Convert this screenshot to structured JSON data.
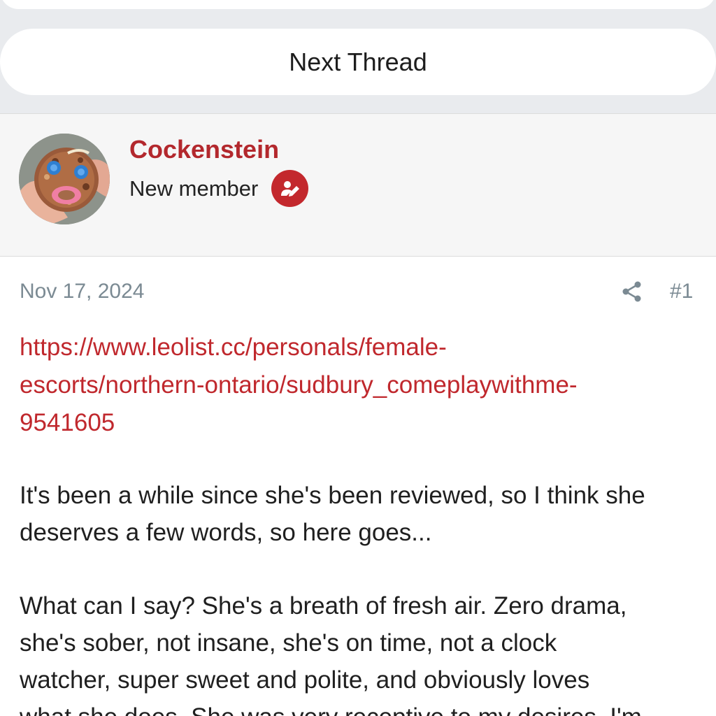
{
  "nav": {
    "next_thread_label": "Next Thread"
  },
  "author": {
    "username": "Cockenstein",
    "user_title": "New member",
    "badge_icon": "user-edit-icon",
    "avatar_icon": "cookie-face-avatar"
  },
  "post": {
    "date": "Nov 17, 2024",
    "share_icon": "share-icon",
    "number": "#1",
    "link_lines": [
      "https://www.leolist.cc/personals/female-",
      "escorts/northern-ontario/sudbury_comeplaywithme-",
      "9541605"
    ],
    "paragraph1_lines": [
      "It's been a while since she's been reviewed, so I think she",
      "deserves a few words, so here goes..."
    ],
    "paragraph2_lines": [
      "What can I say? She's a breath of fresh air. Zero drama,",
      "she's sober, not insane, she's on time, not a clock",
      "watcher, super sweet and polite, and obviously loves",
      "what she does. She was very receptive to my desires. I'm"
    ]
  },
  "colors": {
    "accent": "#c0282d",
    "muted": "#7b8a93",
    "band": "#e9ebee"
  }
}
